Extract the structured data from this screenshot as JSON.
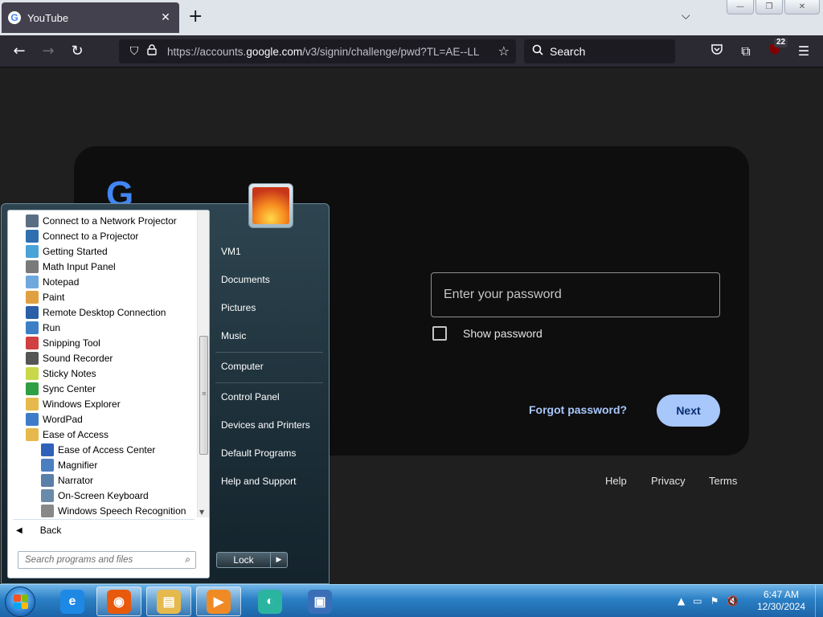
{
  "browser": {
    "tab_title": "YouTube",
    "tab_favicon_letter": "G",
    "tab_close": "✕",
    "new_tab": "+",
    "tab_list": "⌵",
    "url_prefix": "https://accounts.",
    "url_domain": "google.com",
    "url_rest": "/v3/signin/challenge/pwd?TL=AE--LL",
    "search_placeholder": "Search",
    "extension_badge": "22",
    "window_buttons": [
      "—",
      "❐",
      "✕"
    ]
  },
  "signin": {
    "logo": "G",
    "password_placeholder": "Enter your password",
    "show_password_label": "Show password",
    "forgot_password": "Forgot password?",
    "next_button": "Next",
    "footer": [
      "Help",
      "Privacy",
      "Terms"
    ]
  },
  "start_menu": {
    "programs": [
      {
        "label": "Connect to a Network Projector",
        "icon": "network-projector-icon",
        "color": "#5a6e82",
        "indent": 0
      },
      {
        "label": "Connect to a Projector",
        "icon": "projector-icon",
        "color": "#2f6fb0",
        "indent": 0
      },
      {
        "label": "Getting Started",
        "icon": "getting-started-icon",
        "color": "#4aa3d8",
        "indent": 0
      },
      {
        "label": "Math Input Panel",
        "icon": "math-input-icon",
        "color": "#7a7a7a",
        "indent": 0
      },
      {
        "label": "Notepad",
        "icon": "notepad-icon",
        "color": "#6fa8dc",
        "indent": 0
      },
      {
        "label": "Paint",
        "icon": "paint-icon",
        "color": "#e0a040",
        "indent": 0
      },
      {
        "label": "Remote Desktop Connection",
        "icon": "remote-desktop-icon",
        "color": "#2a5ea8",
        "indent": 0
      },
      {
        "label": "Run",
        "icon": "run-icon",
        "color": "#3d7fc6",
        "indent": 0
      },
      {
        "label": "Snipping Tool",
        "icon": "scissors-icon",
        "color": "#d04040",
        "indent": 0
      },
      {
        "label": "Sound Recorder",
        "icon": "microphone-icon",
        "color": "#555555",
        "indent": 0
      },
      {
        "label": "Sticky Notes",
        "icon": "sticky-notes-icon",
        "color": "#c8d84a",
        "indent": 0
      },
      {
        "label": "Sync Center",
        "icon": "sync-icon",
        "color": "#2ea043",
        "indent": 0
      },
      {
        "label": "Windows Explorer",
        "icon": "folder-icon",
        "color": "#e6b94c",
        "indent": 0
      },
      {
        "label": "WordPad",
        "icon": "wordpad-icon",
        "color": "#3e7cc9",
        "indent": 0
      },
      {
        "label": "Ease of Access",
        "icon": "folder-icon",
        "color": "#e6b94c",
        "indent": 0
      },
      {
        "label": "Ease of Access Center",
        "icon": "ease-of-access-icon",
        "color": "#2e62b8",
        "indent": 1
      },
      {
        "label": "Magnifier",
        "icon": "magnifier-icon",
        "color": "#4b7fc0",
        "indent": 1
      },
      {
        "label": "Narrator",
        "icon": "narrator-icon",
        "color": "#5a7fa8",
        "indent": 1
      },
      {
        "label": "On-Screen Keyboard",
        "icon": "keyboard-icon",
        "color": "#6a8aaa",
        "indent": 1
      },
      {
        "label": "Windows Speech Recognition",
        "icon": "microphone-icon",
        "color": "#888888",
        "indent": 1
      }
    ],
    "back_label": "Back",
    "search_placeholder": "Search programs and files",
    "right_pane": [
      "VM1",
      "Documents",
      "Pictures",
      "Music",
      "Computer",
      "Control Panel",
      "Devices and Printers",
      "Default Programs",
      "Help and Support"
    ],
    "lock_label": "Lock",
    "lock_arrow": "▶"
  },
  "taskbar": {
    "pinned": [
      {
        "name": "internet-explorer-icon",
        "glyph": "e",
        "color": "#1e88e5",
        "active": false
      },
      {
        "name": "firefox-icon",
        "glyph": "◉",
        "color": "#e8590c",
        "active": true
      },
      {
        "name": "file-explorer-icon",
        "glyph": "▤",
        "color": "#e6b94c",
        "active": true
      },
      {
        "name": "media-player-icon",
        "glyph": "▶",
        "color": "#f08a24",
        "active": true
      },
      {
        "name": "app-icon",
        "glyph": "◐",
        "color": "#2bb5a0",
        "active": false
      },
      {
        "name": "remote-desktop-icon",
        "glyph": "▣",
        "color": "#3a6fb8",
        "active": false
      }
    ],
    "time": "6:47 AM",
    "date": "12/30/2024"
  }
}
